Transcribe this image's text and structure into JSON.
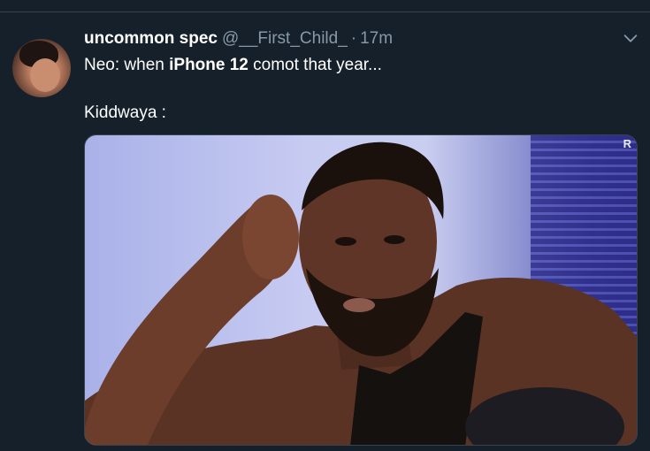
{
  "tweet": {
    "display_name": "uncommon spec",
    "handle": "@__First_Child_",
    "separator": "·",
    "time": "17m",
    "text_line1_prefix": "Neo: when ",
    "text_line1_bold": "iPhone 12",
    "text_line1_suffix": " comot that year...",
    "text_line2": "Kiddwaya :",
    "media_corner_mark": "R"
  },
  "icons": {
    "menu": "chevron-down-icon"
  },
  "colors": {
    "background": "#15202b",
    "secondary_text": "#8899a6",
    "divider": "#38444d"
  }
}
